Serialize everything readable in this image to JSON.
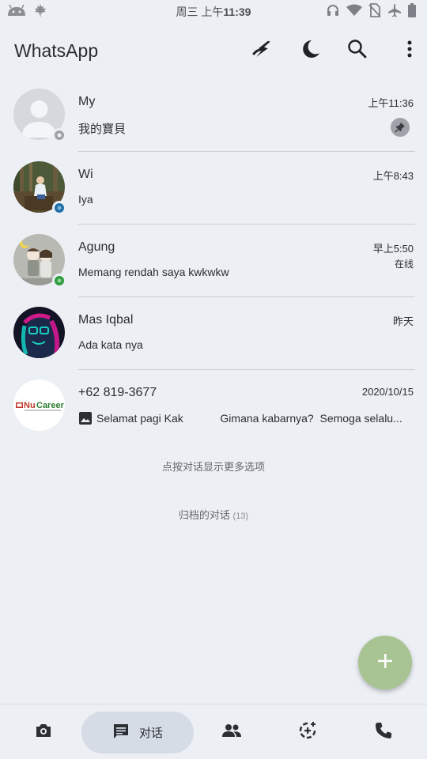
{
  "status_bar": {
    "time_prefix": "周三 上午",
    "time": "11:39",
    "left_icons": [
      "android-icon",
      "maple-leaf-icon"
    ],
    "right_icons": [
      "headphones-icon",
      "wifi-icon",
      "no-sim-icon",
      "airplane-icon",
      "battery-icon"
    ]
  },
  "app_bar": {
    "title": "WhatsApp",
    "actions": [
      "flash-icon",
      "moon-icon",
      "search-icon",
      "more-vert-icon"
    ]
  },
  "chats": [
    {
      "name": "My",
      "time": "上午11:36",
      "message": "我的寶貝",
      "pinned": true,
      "status_color": "#9ea2a7"
    },
    {
      "name": "Wi",
      "time": "上午8:43",
      "message": "Iya",
      "status_color": "#1f6ea8"
    },
    {
      "name": "Agung",
      "time": "早上5:50",
      "sub": "在线",
      "message": "Memang rendah saya kwkwkw",
      "status_color": "#2e9c3c"
    },
    {
      "name": "Mas Iqbal",
      "time": "昨天",
      "message": "Ada kata nya"
    },
    {
      "name": "+62 819-3677",
      "time": "2020/10/15",
      "message": "Selamat pagi Kak            Gimana kabarnya?  Semoga selalu...",
      "avatar_logo_text": "NuCareer"
    }
  ],
  "hint": "点按对话显示更多选项",
  "archived": {
    "label": "归档的对话",
    "count": "(13)"
  },
  "fab": {
    "icon": "plus-icon",
    "color": "#a8c492"
  },
  "bottom_nav": {
    "items": [
      "camera-icon",
      "chats-icon",
      "contacts-icon",
      "status-add-icon",
      "call-icon"
    ],
    "active_label": "对话"
  }
}
